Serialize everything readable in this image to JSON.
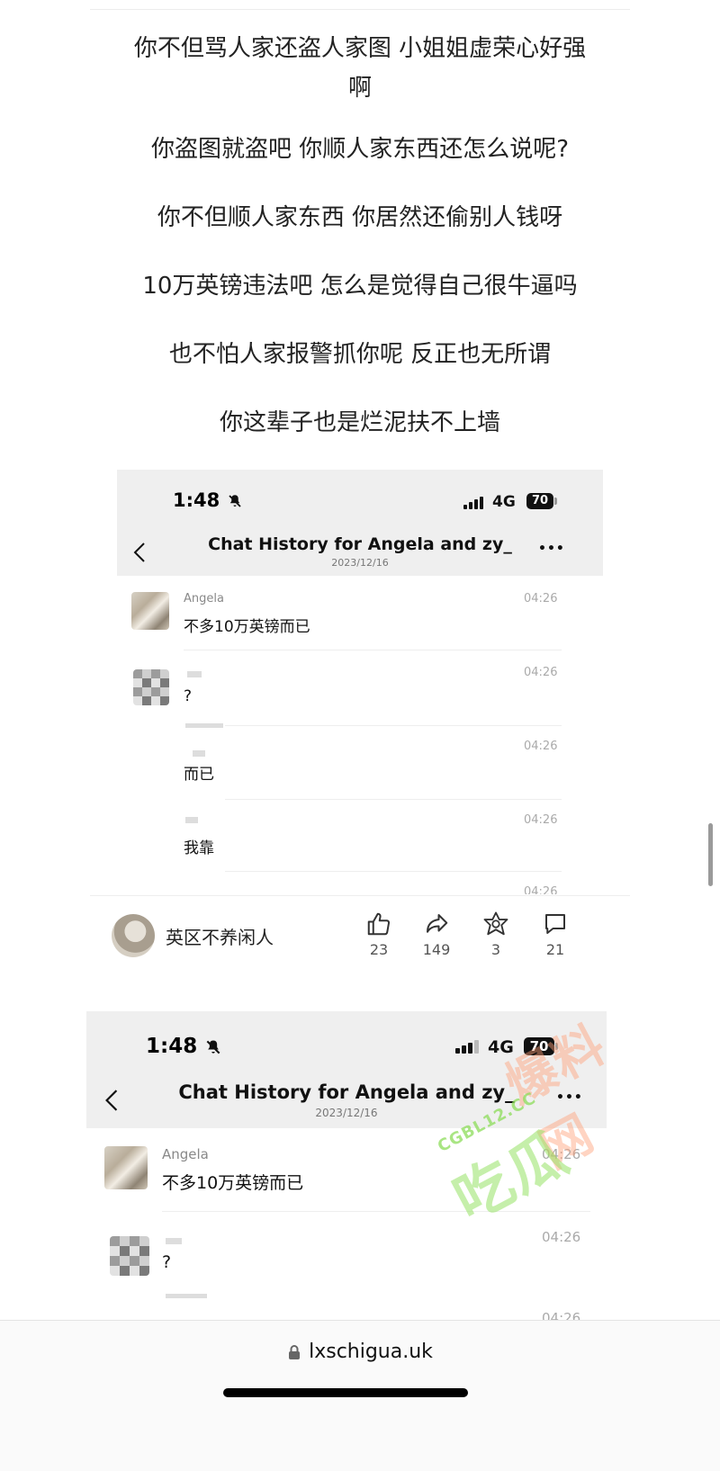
{
  "paragraphs": [
    "你不但骂人家还盗人家图 小姐姐虚荣心好强啊",
    "你盗图就盗吧 你顺人家东西还怎么说呢?",
    "你不但顺人家东西 你居然还偷别人钱呀",
    "10万英镑违法吧 怎么是觉得自己很牛逼吗",
    "也不怕人家报警抓你呢 反正也无所谓",
    "你这辈子也是烂泥扶不上墙"
  ],
  "chat_screenshot": {
    "status_time": "1:48",
    "network": "4G",
    "battery": "70",
    "title": "Chat History for Angela and zy_",
    "date": "2023/12/16",
    "more": "•••",
    "messages": [
      {
        "sender": "Angela",
        "text": "不多10万英镑而已",
        "time": "04:26"
      },
      {
        "sender": "",
        "text": "?",
        "time": "04:26"
      },
      {
        "sender": "",
        "text": "而已",
        "time": "04:26"
      },
      {
        "sender": "",
        "text": "我靠",
        "time": "04:26"
      },
      {
        "sender": "",
        "text": "",
        "time": "04:26"
      }
    ]
  },
  "author": {
    "name": "英区不养闲人"
  },
  "actions": [
    {
      "icon": "thumbs-up-icon",
      "count": "23"
    },
    {
      "icon": "share-icon",
      "count": "149"
    },
    {
      "icon": "favorite-icon",
      "count": "3"
    },
    {
      "icon": "comment-icon",
      "count": "21"
    }
  ],
  "watermark": {
    "small": "CGBL12.CC",
    "big": "吃瓜",
    "big2": "爆料网"
  },
  "browser": {
    "url": "lxschigua.uk"
  }
}
